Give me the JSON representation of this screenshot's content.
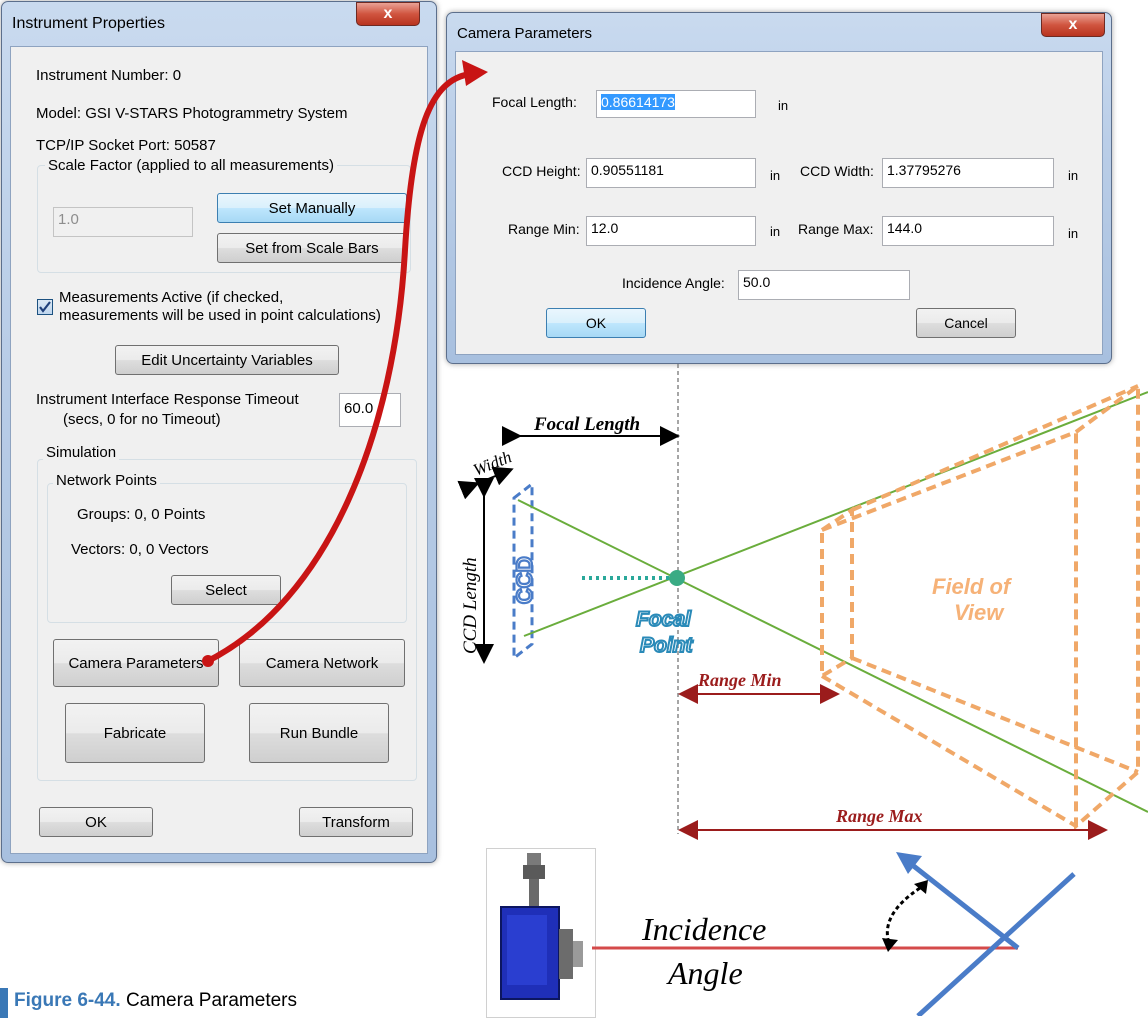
{
  "instrument_dialog": {
    "title": "Instrument Properties",
    "close_glyph": "x",
    "instrument_number": "Instrument Number:  0",
    "model": "Model:  GSI V-STARS Photogrammetry System",
    "port": "TCP/IP Socket Port: 50587",
    "scale_group_label": "Scale Factor (applied to all measurements)",
    "scale_value": "1.0",
    "set_manually": "Set Manually",
    "set_from_scale_bars": "Set from Scale Bars",
    "measurements_active_line1": "Measurements Active (if checked,",
    "measurements_active_line2": "measurements will be used in point calculations)",
    "edit_uncertainty": "Edit Uncertainty Variables",
    "timeout_line1": "Instrument Interface Response Timeout",
    "timeout_line2": "(secs, 0 for no Timeout)",
    "timeout_value": "60.0",
    "simulation_label": "Simulation",
    "network_points_label": "Network Points",
    "groups": "Groups:  0, 0 Points",
    "vectors": "Vectors:  0, 0 Vectors",
    "select": "Select",
    "camera_parameters": "Camera Parameters",
    "camera_network": "Camera Network",
    "fabricate": "Fabricate",
    "run_bundle": "Run Bundle",
    "ok": "OK",
    "transform": "Transform"
  },
  "camera_dialog": {
    "title": "Camera Parameters",
    "close_glyph": "x",
    "focal_length_label": "Focal Length:",
    "focal_length_value": "0.86614173",
    "ccd_height_label": "CCD Height:",
    "ccd_height_value": "0.90551181",
    "ccd_width_label": "CCD Width:",
    "ccd_width_value": "1.37795276",
    "range_min_label": "Range Min:",
    "range_min_value": "12.0",
    "range_max_label": "Range Max:",
    "range_max_value": "144.0",
    "incidence_label": "Incidence Angle:",
    "incidence_value": "50.0",
    "unit": "in",
    "ok": "OK",
    "cancel": "Cancel"
  },
  "diagram": {
    "focal_length": "Focal Length",
    "width": "Width",
    "ccd_length": "CCD Length",
    "ccd": "CCD",
    "focal_point_1": "Focal",
    "focal_point_2": "Point",
    "field_of_view_1": "Field of",
    "field_of_view_2": "View",
    "range_min": "Range Min",
    "range_max": "Range Max",
    "incidence_1": "Incidence",
    "incidence_2": "Angle"
  },
  "caption": {
    "figure": "Figure 6-44.",
    "text": "Camera Parameters"
  },
  "colors": {
    "accent_blue": "#3a78b6",
    "arrow_red": "#c81414",
    "fov_orange": "#f0a868",
    "ccd_blue": "#4a7cc8",
    "ray_green": "#6aad3c",
    "dim_red": "#9b1c1c"
  }
}
